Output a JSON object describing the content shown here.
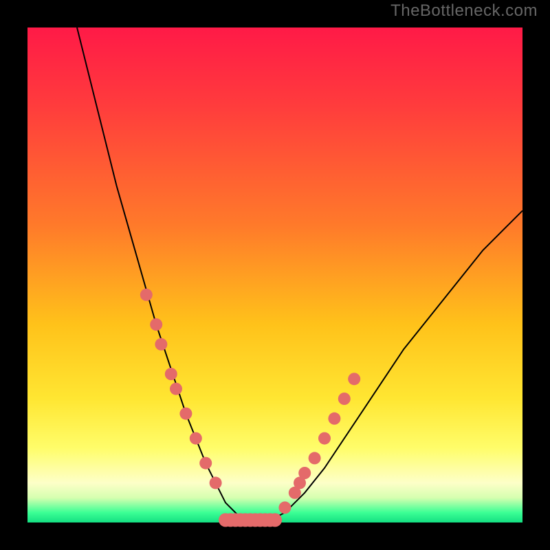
{
  "watermark": "TheBottleneck.com",
  "chart_data": {
    "type": "line",
    "title": "",
    "xlabel": "",
    "ylabel": "",
    "xlim": [
      0,
      100
    ],
    "ylim": [
      0,
      100
    ],
    "grid": false,
    "legend": false,
    "series": [
      {
        "name": "curve",
        "x": [
          10,
          12,
          14,
          16,
          18,
          20,
          22,
          24,
          26,
          28,
          30,
          32,
          34,
          36,
          38,
          40,
          44,
          48,
          52,
          56,
          60,
          64,
          68,
          72,
          76,
          80,
          84,
          88,
          92,
          96,
          100
        ],
        "y": [
          100,
          92,
          84,
          76,
          68,
          61,
          54,
          47,
          40,
          34,
          28,
          22,
          17,
          12,
          8,
          4,
          0,
          0,
          2,
          6,
          11,
          17,
          23,
          29,
          35,
          40,
          45,
          50,
          55,
          59,
          63
        ]
      }
    ],
    "minimum_x": 46,
    "left_branch_dots": [
      {
        "x": 24,
        "y": 46
      },
      {
        "x": 26,
        "y": 40
      },
      {
        "x": 27,
        "y": 36
      },
      {
        "x": 29,
        "y": 30
      },
      {
        "x": 30,
        "y": 27
      },
      {
        "x": 32,
        "y": 22
      },
      {
        "x": 34,
        "y": 17
      },
      {
        "x": 36,
        "y": 12
      },
      {
        "x": 38,
        "y": 8
      }
    ],
    "right_branch_dots": [
      {
        "x": 52,
        "y": 3
      },
      {
        "x": 54,
        "y": 6
      },
      {
        "x": 55,
        "y": 8
      },
      {
        "x": 56,
        "y": 10
      },
      {
        "x": 58,
        "y": 13
      },
      {
        "x": 60,
        "y": 17
      },
      {
        "x": 62,
        "y": 21
      },
      {
        "x": 64,
        "y": 25
      },
      {
        "x": 66,
        "y": 29
      }
    ],
    "bottom_cluster_x_range": [
      40,
      50
    ],
    "gradient_stops": [
      {
        "pct": 0,
        "color": "#ff1a47"
      },
      {
        "pct": 40,
        "color": "#ff7a2a"
      },
      {
        "pct": 75,
        "color": "#ffe632"
      },
      {
        "pct": 92,
        "color": "#fdffc8"
      },
      {
        "pct": 100,
        "color": "#14df82"
      }
    ]
  }
}
